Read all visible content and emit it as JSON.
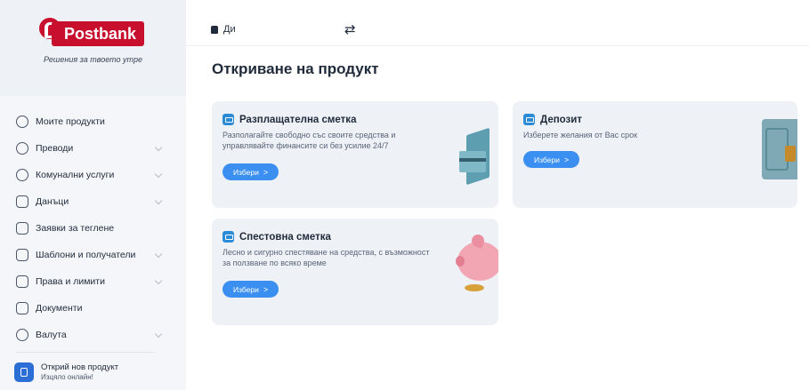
{
  "brand": {
    "name": "Postbank",
    "tagline": "Решения за твоето утре"
  },
  "colors": {
    "brand_red": "#c8102e",
    "accent_blue": "#3a8ff0",
    "card_bg": "#eef1f6"
  },
  "sidebar": {
    "items": [
      {
        "label": "Моите продукти",
        "icon": "home-icon",
        "expandable": false
      },
      {
        "label": "Преводи",
        "icon": "transfer-icon",
        "expandable": true
      },
      {
        "label": "Комунални услуги",
        "icon": "bulb-icon",
        "expandable": true
      },
      {
        "label": "Данъци",
        "icon": "tax-document-icon",
        "expandable": true
      },
      {
        "label": "Заявки за теглене",
        "icon": "bank-icon",
        "expandable": false
      },
      {
        "label": "Шаблони и получатели",
        "icon": "template-icon",
        "expandable": true
      },
      {
        "label": "Права и лимити",
        "icon": "limits-icon",
        "expandable": true
      },
      {
        "label": "Документи",
        "icon": "documents-icon",
        "expandable": false
      },
      {
        "label": "Валута",
        "icon": "currency-icon",
        "expandable": true
      }
    ],
    "promo": {
      "title": "Открий нов продукт",
      "subtitle": "Изцяло онлайн!"
    }
  },
  "topbar": {
    "user_name": "Ди",
    "swap_icon": "⇄"
  },
  "main": {
    "title": "Откриване на продукт",
    "cards": [
      {
        "title": "Разплащателна сметка",
        "description_line1": "Разполагайте свободно със своите средства и",
        "description_line2": "управлявайте финансите си без усилие 24/7",
        "button": "Избери",
        "button_arrow": ">"
      },
      {
        "title": "Депозит",
        "description_line1": "Изберете желания от Вас срок",
        "description_line2": "",
        "button": "Избери",
        "button_arrow": ">"
      },
      {
        "title": "Спестовна сметка",
        "description_line1": "Лесно и сигурно спестяване на средства, с възможност",
        "description_line2": "за ползване по всяко време",
        "button": "Избери",
        "button_arrow": ">"
      }
    ]
  }
}
